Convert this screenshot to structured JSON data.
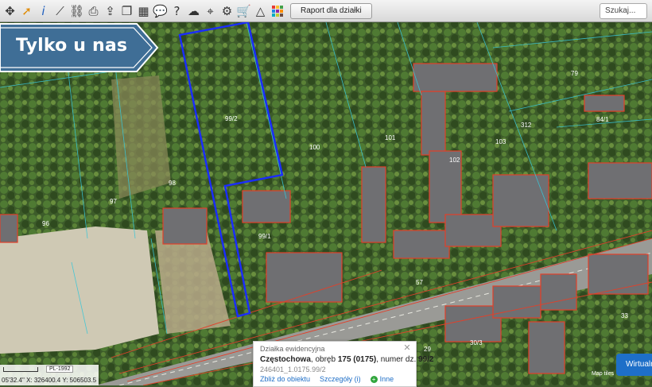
{
  "toolbar": {
    "report_button": "Raport dla działki",
    "search_placeholder": "Szukaj...",
    "icons": [
      "pan-icon",
      "select-arrow-icon",
      "info-icon",
      "measure-line-icon",
      "link-icon",
      "print-icon",
      "export-icon",
      "copy-icon",
      "layers-icon",
      "comment-icon",
      "help-icon",
      "cloud-icon",
      "locate-icon",
      "settings-icon",
      "cart-icon",
      "triangle-icon",
      "colors-icon"
    ]
  },
  "promo": {
    "text": "Tylko u nas"
  },
  "map": {
    "parcel_labels": [
      "99/2",
      "100",
      "101",
      "102",
      "103",
      "98",
      "97",
      "96",
      "99/1",
      "57",
      "29",
      "30/3",
      "33",
      "312",
      "84/1",
      "79"
    ],
    "highlight_color": "#1a2cff",
    "building_outline_color": "#e2402a"
  },
  "popup": {
    "header": "Działka ewidencyjna",
    "city": "Częstochowa",
    "precinct_prefix": ", obręb ",
    "precinct": "175 (0175)",
    "number_prefix": ", numer dz. ",
    "number": "99/2",
    "identifier": "246401_1.0175.99/2",
    "link_zoom": "Zbliż do obiektu",
    "link_details": "Szczegóły (i)",
    "link_other": "Inne"
  },
  "status": {
    "crs": "PL-1992",
    "lon": "05'32.4\"",
    "x": "X: 326400.4",
    "y": "Y: 506503.5"
  },
  "overlay": {
    "virtual_button": "Wirtualny",
    "map_tiles": "Map tiles"
  }
}
